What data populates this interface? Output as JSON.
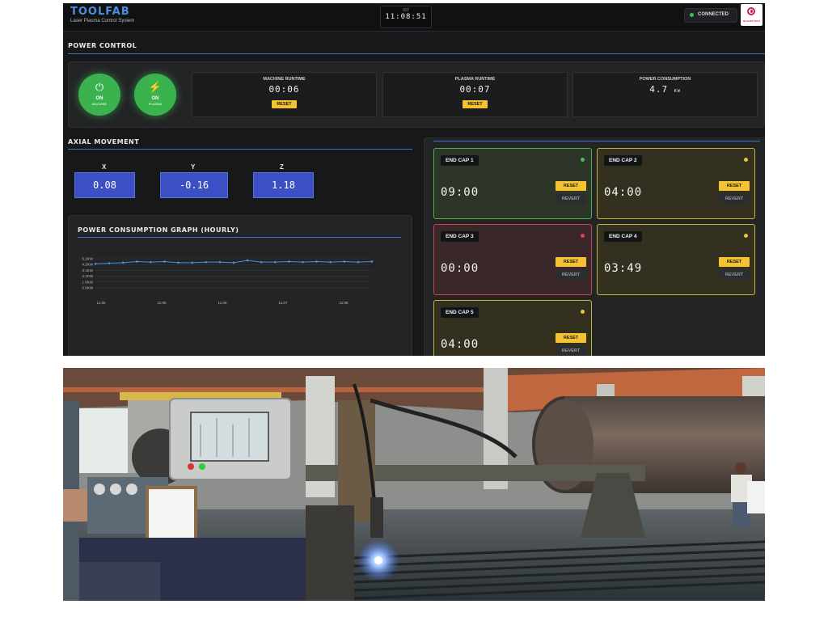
{
  "header": {
    "brand": "TOOLFAB",
    "subtitle": "Laser Plasma Control System",
    "clock_zone": "IST",
    "clock_time": "11:08:51",
    "connection": "CONNECTED",
    "logo_caption": "BLOGIN TECH"
  },
  "power_control": {
    "title": "POWER CONTROL",
    "machine_button": {
      "state": "ON",
      "label": "MACHINE"
    },
    "plasma_button": {
      "state": "ON",
      "label": "PLASMA"
    },
    "machine_runtime": {
      "label": "MACHINE RUNTIME",
      "value": "00:06",
      "button": "RESET"
    },
    "plasma_runtime": {
      "label": "PLASMA RUNTIME",
      "value": "00:07",
      "button": "RESET"
    },
    "power_consumption": {
      "label": "POWER CONSUMPTION",
      "value": "4.7",
      "unit": "KW"
    }
  },
  "axial": {
    "title": "AXIAL MOVEMENT",
    "x": {
      "label": "X",
      "value": "0.08"
    },
    "y": {
      "label": "Y",
      "value": "-0.16"
    },
    "z": {
      "label": "Z",
      "value": "1.18"
    }
  },
  "graph": {
    "title": "POWER CONSUMPTION GRAPH (HOURLY)"
  },
  "chart_data": {
    "type": "line",
    "title": "POWER CONSUMPTION GRAPH (HOURLY)",
    "y_ticks": [
      "5.2KW",
      "4.2KW",
      "3.1KW",
      "2.1KW",
      "1.0KW",
      "0.0KW"
    ],
    "x_ticks": [
      "11:05",
      "11:06",
      "11:06",
      "11:07",
      "11:08"
    ],
    "ylim": [
      0,
      5.2
    ],
    "series": [
      {
        "color": "#4c8ee0",
        "values": [
          4.3,
          4.4,
          4.5,
          4.7,
          4.6,
          4.7,
          4.5,
          4.5,
          4.6,
          4.6,
          4.5,
          4.9,
          4.6,
          4.6,
          4.7,
          4.6,
          4.7,
          4.6,
          4.7,
          4.6,
          4.7
        ]
      }
    ],
    "grid": true
  },
  "end_caps": [
    {
      "name": "END CAP 1",
      "time": "09:00",
      "status": "green",
      "reset": "RESET",
      "revert": "REVERT"
    },
    {
      "name": "END CAP 2",
      "time": "04:00",
      "status": "yellow",
      "reset": "RESET",
      "revert": "REVERT"
    },
    {
      "name": "END CAP 3",
      "time": "00:00",
      "status": "red",
      "reset": "RESET",
      "revert": "REVERT"
    },
    {
      "name": "END CAP 4",
      "time": "03:49",
      "status": "yellow",
      "reset": "RESET",
      "revert": "REVERT"
    },
    {
      "name": "END CAP 5",
      "time": "04:00",
      "status": "yellow",
      "reset": "RESET",
      "revert": "REVERT"
    }
  ],
  "colors": {
    "accent": "#4c8ee0",
    "on_green": "#3ab34e",
    "reset_yellow": "#f5c232",
    "axis_blue": "#3d4fc4"
  }
}
